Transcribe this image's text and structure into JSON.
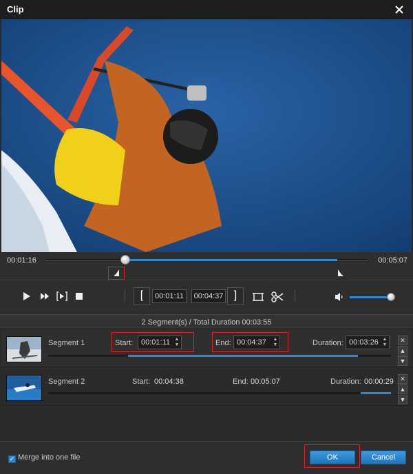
{
  "window": {
    "title": "Clip"
  },
  "player": {
    "current_time": "00:01:16",
    "total_time": "00:05:07",
    "progress_fraction": 0.26,
    "range_start_fraction": 0.26,
    "range_end_fraction": 0.9,
    "start_time": "00:01:11",
    "end_time": "00:04:37",
    "volume_fraction": 0.9
  },
  "summary": {
    "text": "2 Segment(s) / Total Duration 00:03:55"
  },
  "segments": [
    {
      "name": "Segment 1",
      "start_label": "Start:",
      "start": "00:01:11",
      "end_label": "End:",
      "end": "00:04:37",
      "duration_label": "Duration:",
      "duration": "00:03:26"
    },
    {
      "name": "Segment 2",
      "start_label": "Start:",
      "start": "00:04:38",
      "end_label": "End:",
      "end": "00:05:07",
      "duration_label": "Duration:",
      "duration": "00:00:29"
    }
  ],
  "footer": {
    "merge_label": "Merge into one file",
    "merge_checked": true,
    "ok_label": "OK",
    "cancel_label": "Cancel"
  },
  "colors": {
    "accent": "#2c8ad4",
    "highlight": "#e0222a",
    "background": "#2b2b2b"
  },
  "icons": [
    "close-icon",
    "play-icon",
    "fast-forward-icon",
    "frame-step-icon",
    "stop-icon",
    "crop-icon",
    "scissors-icon",
    "volume-icon",
    "spin-up-icon",
    "spin-down-icon",
    "remove-icon",
    "move-up-icon",
    "move-down-icon",
    "checkbox-icon"
  ]
}
